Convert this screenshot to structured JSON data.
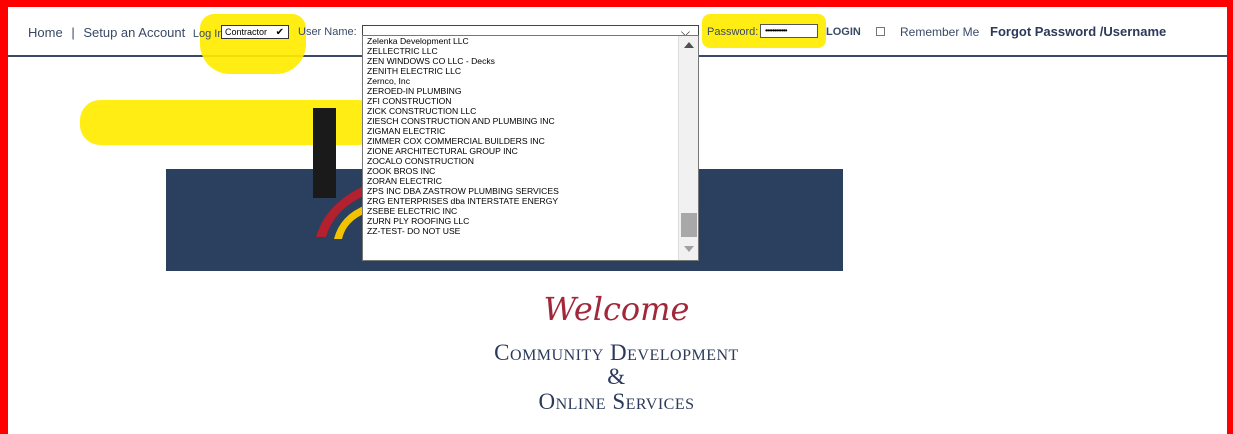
{
  "nav": {
    "home": "Home",
    "separator": "|",
    "setup_account": "Setup an Account",
    "log_in_label": "Log In",
    "role_select": "Contractor",
    "username_label": "User Name:",
    "password_label": "Password:",
    "password_value": "••••••••••••",
    "login_button": "LOGIN",
    "remember_me": "Remember Me",
    "forgot": "Forgot Password /Username"
  },
  "dropdown": {
    "items": [
      "Zelenka Development LLC",
      "ZELLECTRIC LLC",
      "ZEN WINDOWS CO LLC - Decks",
      "ZENITH ELECTRIC LLC",
      "Zernco, Inc",
      "ZEROED-IN PLUMBING",
      "ZFI CONSTRUCTION",
      "ZICK CONSTRUCTION LLC",
      "ZIESCH CONSTRUCTION AND PLUMBING INC",
      "ZIGMAN ELECTRIC",
      "ZIMMER COX COMMERCIAL BUILDERS INC",
      "ZIONE ARCHITECTURAL GROUP INC",
      "ZOCALO CONSTRUCTION",
      "ZOOK BROS INC",
      "ZORAN ELECTRIC",
      "ZPS INC DBA ZASTROW PLUMBING SERVICES",
      "ZRG ENTERPRISES dba INTERSTATE ENERGY",
      "ZSEBE ELECTRIC INC",
      "ZURN PLY ROOFING LLC",
      "ZZ-TEST- DO NOT USE"
    ]
  },
  "welcome": {
    "greeting": "Welcome",
    "line1": "Community Development",
    "line2": "&",
    "line3": "Online Services"
  },
  "colors": {
    "frame": "#ff0000",
    "highlight": "#ffec00",
    "navy": "#2b3f5e",
    "welcome": "#a0283a"
  }
}
